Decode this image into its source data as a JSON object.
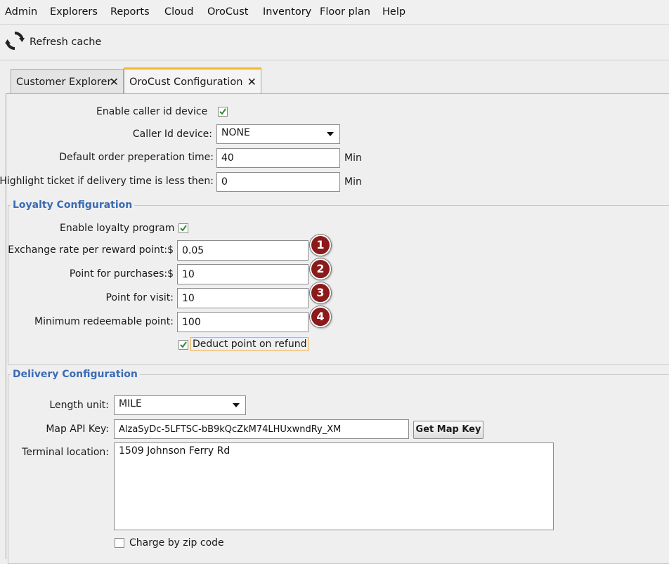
{
  "menu": [
    "Admin",
    "Explorers",
    "Reports",
    "Cloud",
    "OroCust",
    "Inventory",
    "Floor plan",
    "Help"
  ],
  "toolbar": {
    "refresh_label": "Refresh cache",
    "refresh_icon": "refresh-icon"
  },
  "tabs": [
    {
      "label": "Customer Explorer",
      "active": false,
      "close": "✕"
    },
    {
      "label": "OroCust Configuration",
      "active": true,
      "close": "✕"
    }
  ],
  "caller": {
    "enable_label": "Enable caller id device",
    "enable_checked": true,
    "device_label": "Caller Id device:",
    "device_value": "NONE",
    "prep_label": "Default order preperation time:",
    "prep_value": "40",
    "prep_unit": "Min",
    "highlight_label": "Highlight ticket if delivery time is less then:",
    "highlight_value": "0",
    "highlight_unit": "Min"
  },
  "loyalty": {
    "title": "Loyalty Configuration",
    "enable_label": "Enable loyalty program",
    "enable_checked": true,
    "exchange_label": "Exchange rate per reward point:$",
    "exchange_value": "0.05",
    "purchase_label": "Point for purchases:$",
    "purchase_value": "10",
    "visit_label": "Point for visit:",
    "visit_value": "10",
    "min_label": "Minimum redeemable point:",
    "min_value": "100",
    "deduct_label": "Deduct point on refund",
    "deduct_checked": true,
    "badges": [
      "1",
      "2",
      "3",
      "4"
    ],
    "badge_color": "#8b1a1a"
  },
  "delivery": {
    "title": "Delivery Configuration",
    "length_label": "Length unit:",
    "length_value": "MILE",
    "map_label": "Map API Key:",
    "map_value": "AlzaSyDc-5LFTSC-bB9kQcZkM74LHUxwndRy_XM",
    "map_button": "Get Map Key",
    "terminal_label": "Terminal location:",
    "terminal_value": "1509 Johnson Ferry Rd",
    "zip_label": "Charge by zip code",
    "zip_checked": false
  },
  "colors": {
    "group_title": "#3b6bb5",
    "active_tab_accent": "#f2b830",
    "check": "#2e8b2e"
  }
}
